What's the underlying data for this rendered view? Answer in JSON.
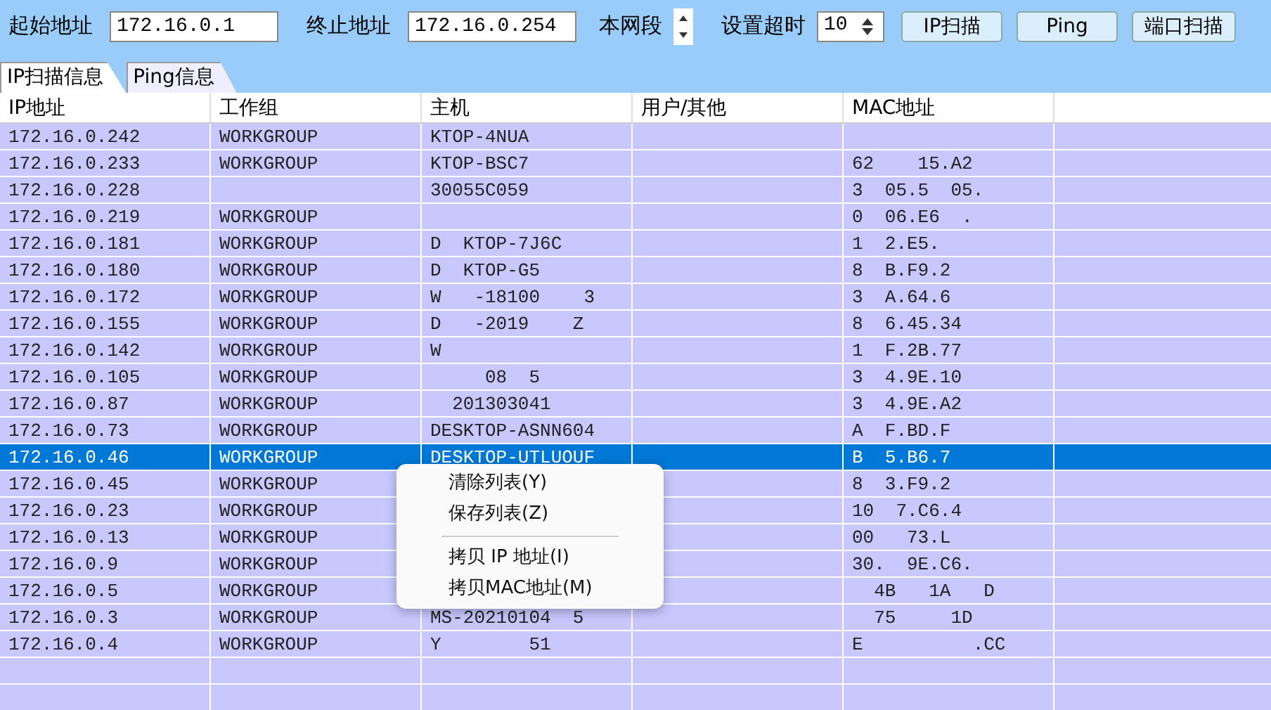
{
  "toolbar": {
    "start_label": "起始地址",
    "start_value": "172.16.0.1",
    "end_label": "终止地址",
    "end_value": "172.16.0.254",
    "segment_label": "本网段",
    "timeout_label": "设置超时",
    "timeout_value": "10",
    "buttons": [
      "IP扫描",
      "Ping",
      "端口扫描"
    ]
  },
  "tabs": [
    {
      "label": "IP扫描信息",
      "selected": true
    },
    {
      "label": "Ping信息",
      "selected": false
    }
  ],
  "table": {
    "columns": [
      "IP地址",
      "工作组",
      "主机",
      "用户/其他",
      "MAC地址"
    ],
    "rows": [
      {
        "ip": "172.16.0.242",
        "group": "WORKGROUP",
        "host": "KTOP-4NUA",
        "selected": false
      },
      {
        "ip": "172.16.0.233",
        "group": "WORKGROUP",
        "host": "KTOP-BSC7",
        "mac": "62    15.A2",
        "selected": false
      },
      {
        "ip": "172.16.0.228",
        "host": "30055C059",
        "mac": "3  05.5  05.",
        "selected": false
      },
      {
        "ip": "172.16.0.219",
        "group": "WORKGROUP",
        "mac": "0  06.E6  .",
        "selected": false
      },
      {
        "ip": "172.16.0.181",
        "group": "WORKGROUP",
        "host": "D  KTOP-7J6C",
        "mac": "1  2.E5.",
        "selected": false
      },
      {
        "ip": "172.16.0.180",
        "group": "WORKGROUP",
        "host": "D  KTOP-G5",
        "mac": "8  B.F9.2",
        "selected": false
      },
      {
        "ip": "172.16.0.172",
        "group": "WORKGROUP",
        "host": "W   -18100    3",
        "mac": "3  A.64.6",
        "selected": false
      },
      {
        "ip": "172.16.0.155",
        "group": "WORKGROUP",
        "host": "D   -2019    Z",
        "mac": "8  6.45.34",
        "selected": false
      },
      {
        "ip": "172.16.0.142",
        "group": "WORKGROUP",
        "host": "W",
        "mac": "1  F.2B.77",
        "selected": false
      },
      {
        "ip": "172.16.0.105",
        "group": "WORKGROUP",
        "host": "     08  5",
        "mac": "3  4.9E.10",
        "selected": false
      },
      {
        "ip": "172.16.0.87",
        "group": "WORKGROUP",
        "host": "  201303041",
        "mac": "3  4.9E.A2",
        "selected": false
      },
      {
        "ip": "172.16.0.73",
        "group": "WORKGROUP",
        "host": "DESKTOP-ASNN604",
        "mac": "A  F.BD.F",
        "selected": false
      },
      {
        "ip": "172.16.0.46",
        "group": "WORKGROUP",
        "host": "DESKTOP-UTLUOUF",
        "mac": "B  5.B6.7",
        "selected": true
      },
      {
        "ip": "172.16.0.45",
        "group": "WORKGROUP",
        "mac": "8  3.F9.2",
        "selected": false
      },
      {
        "ip": "172.16.0.23",
        "group": "WORKGROUP",
        "mac": "10  7.C6.4",
        "selected": false
      },
      {
        "ip": "172.16.0.13",
        "group": "WORKGROUP",
        "mac": "00   73.L",
        "selected": false
      },
      {
        "ip": "172.16.0.9",
        "group": "WORKGROUP",
        "mac": "30.  9E.C6.",
        "selected": false
      },
      {
        "ip": "172.16.0.5",
        "group": "WORKGROUP",
        "mac": "  4B   1A   D",
        "selected": false
      },
      {
        "ip": "172.16.0.3",
        "group": "WORKGROUP",
        "host": "MS-20210104  5",
        "mac": "  75     1D",
        "selected": false
      },
      {
        "ip": "172.16.0.4",
        "group": "WORKGROUP",
        "host": "Y        51",
        "mac": "E          .CC",
        "selected": false
      }
    ]
  },
  "context_menu": [
    {
      "kind": "item",
      "label": "清除列表(Y)"
    },
    {
      "kind": "item",
      "label": "保存列表(Z)"
    },
    {
      "kind": "separator"
    },
    {
      "kind": "item",
      "label": "拷贝 IP 地址(I)"
    },
    {
      "kind": "item",
      "label": "拷贝MAC地址(M)"
    }
  ]
}
